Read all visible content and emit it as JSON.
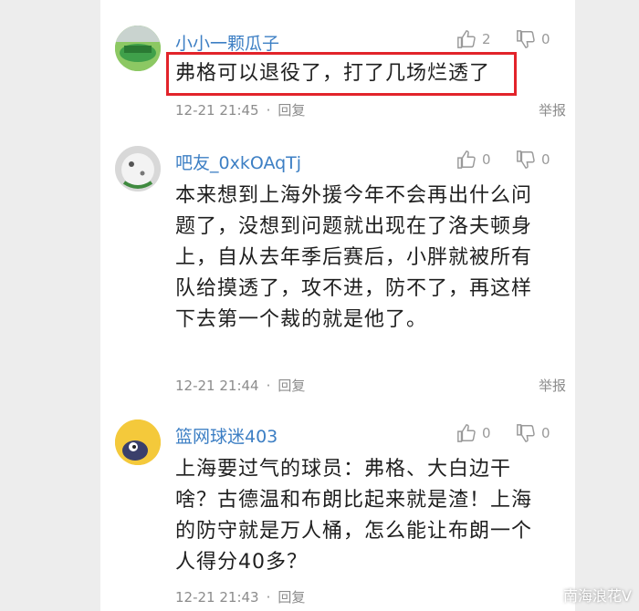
{
  "comments": [
    {
      "username": "小小一颗瓜子",
      "likes": "2",
      "dislikes": "0",
      "text": "弗格可以退役了，打了几场烂透了",
      "time": "12-21 21:45",
      "reply": "回复",
      "report": "举报"
    },
    {
      "username": "吧友_0xkOAqTj",
      "likes": "0",
      "dislikes": "0",
      "text": "本来想到上海外援今年不会再出什么问题了，没想到问题就出现在了洛夫顿身上，自从去年季后赛后，小胖就被所有队给摸透了，攻不进，防不了，再这样下去第一个裁的就是他了。",
      "time": "12-21 21:44",
      "reply": "回复",
      "report": "举报"
    },
    {
      "username": "篮网球迷403",
      "likes": "0",
      "dislikes": "0",
      "text": "上海要过气的球员：弗格、大白边干啥？古德温和布朗比起来就是渣！上海的防守就是万人桶，怎么能让布朗一个人得分40多？",
      "time": "12-21 21:43",
      "reply": "回复",
      "report": ""
    }
  ],
  "watermark": "南海浪花V",
  "colors": {
    "username": "#3d7fc4",
    "highlight_border": "#e2232a",
    "meta": "#8c8c8c"
  }
}
